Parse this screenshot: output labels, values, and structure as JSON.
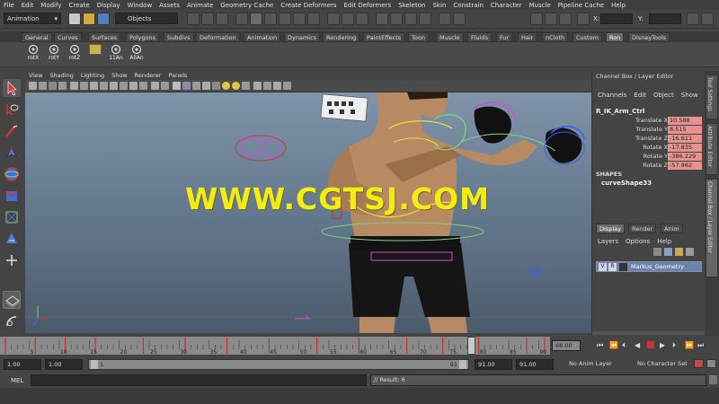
{
  "menubar": [
    "File",
    "Edit",
    "Modify",
    "Create",
    "Display",
    "Window",
    "Assets",
    "Animate",
    "Geometry Cache",
    "Create Deformers",
    "Edit Deformers",
    "Skeleton",
    "Skin",
    "Constrain",
    "Character",
    "Muscle",
    "Pipeline Cache",
    "Help"
  ],
  "status": {
    "mode": "Animation",
    "selection_mode": "Objects",
    "x_label": "X:",
    "y_label": "Y:"
  },
  "shelf_tabs": [
    "General",
    "Curves",
    "Surfaces",
    "Polygons",
    "Subdivs",
    "Deformation",
    "Animation",
    "Dynamics",
    "Rendering",
    "PaintEffects",
    "Toon",
    "Muscle",
    "Fluids",
    "Fur",
    "Hair",
    "nCloth",
    "Custom",
    "Ron",
    "DisneyTools"
  ],
  "active_shelf": "Ron",
  "shelf_buttons": [
    "rotX",
    "rotY",
    "rotZ",
    "",
    "11An",
    "AllAn"
  ],
  "panel_menu": [
    "View",
    "Shading",
    "Lighting",
    "Show",
    "Renderer",
    "Panels"
  ],
  "channel_box": {
    "title": "Channel Box / Layer Editor",
    "menu": [
      "Channels",
      "Edit",
      "Object",
      "Show"
    ],
    "object": "R_IK_Arm_Ctrl",
    "attributes": [
      {
        "name": "Translate X",
        "value": "10.588"
      },
      {
        "name": "Translate Y",
        "value": "8.515"
      },
      {
        "name": "Translate Z",
        "value": "-16.611"
      },
      {
        "name": "Rotate X",
        "value": "-17.835"
      },
      {
        "name": "Rotate Y",
        "value": "-386.229"
      },
      {
        "name": "Rotate Z",
        "value": "-57.962"
      }
    ],
    "shapes_label": "SHAPES",
    "shape": "curveShape33"
  },
  "layer_editor": {
    "tabs": [
      "Display",
      "Render",
      "Anim"
    ],
    "menu": [
      "Layers",
      "Options",
      "Help"
    ],
    "layer": {
      "v": "V",
      "r": "R",
      "name": "Markus_Geometry"
    }
  },
  "side_tabs": [
    "Tool Settings",
    "Attribute Editor",
    "Channel Box / Layer Editor"
  ],
  "watermark": "WWW.CGTSJ.COM",
  "timeline": {
    "ticks": [
      "5",
      "10",
      "15",
      "20",
      "25",
      "30",
      "35",
      "40",
      "45",
      "50",
      "55",
      "60",
      "65",
      "70",
      "75",
      "80",
      "85",
      "90"
    ],
    "current_frame": "68.00"
  },
  "range": {
    "start": "1.00",
    "inner_start": "1.00",
    "range_start_label": "1",
    "range_end_label": "91",
    "inner_end": "91.00",
    "end": "91.00",
    "anim_layer": "No Anim Layer",
    "character_set": "No Character Set"
  },
  "command": {
    "label": "MEL",
    "result": "// Result: 6"
  },
  "colors": {
    "keyframe": "#cc2222",
    "attr_highlight": "#e8928f",
    "watermark": "#f3ec14"
  }
}
